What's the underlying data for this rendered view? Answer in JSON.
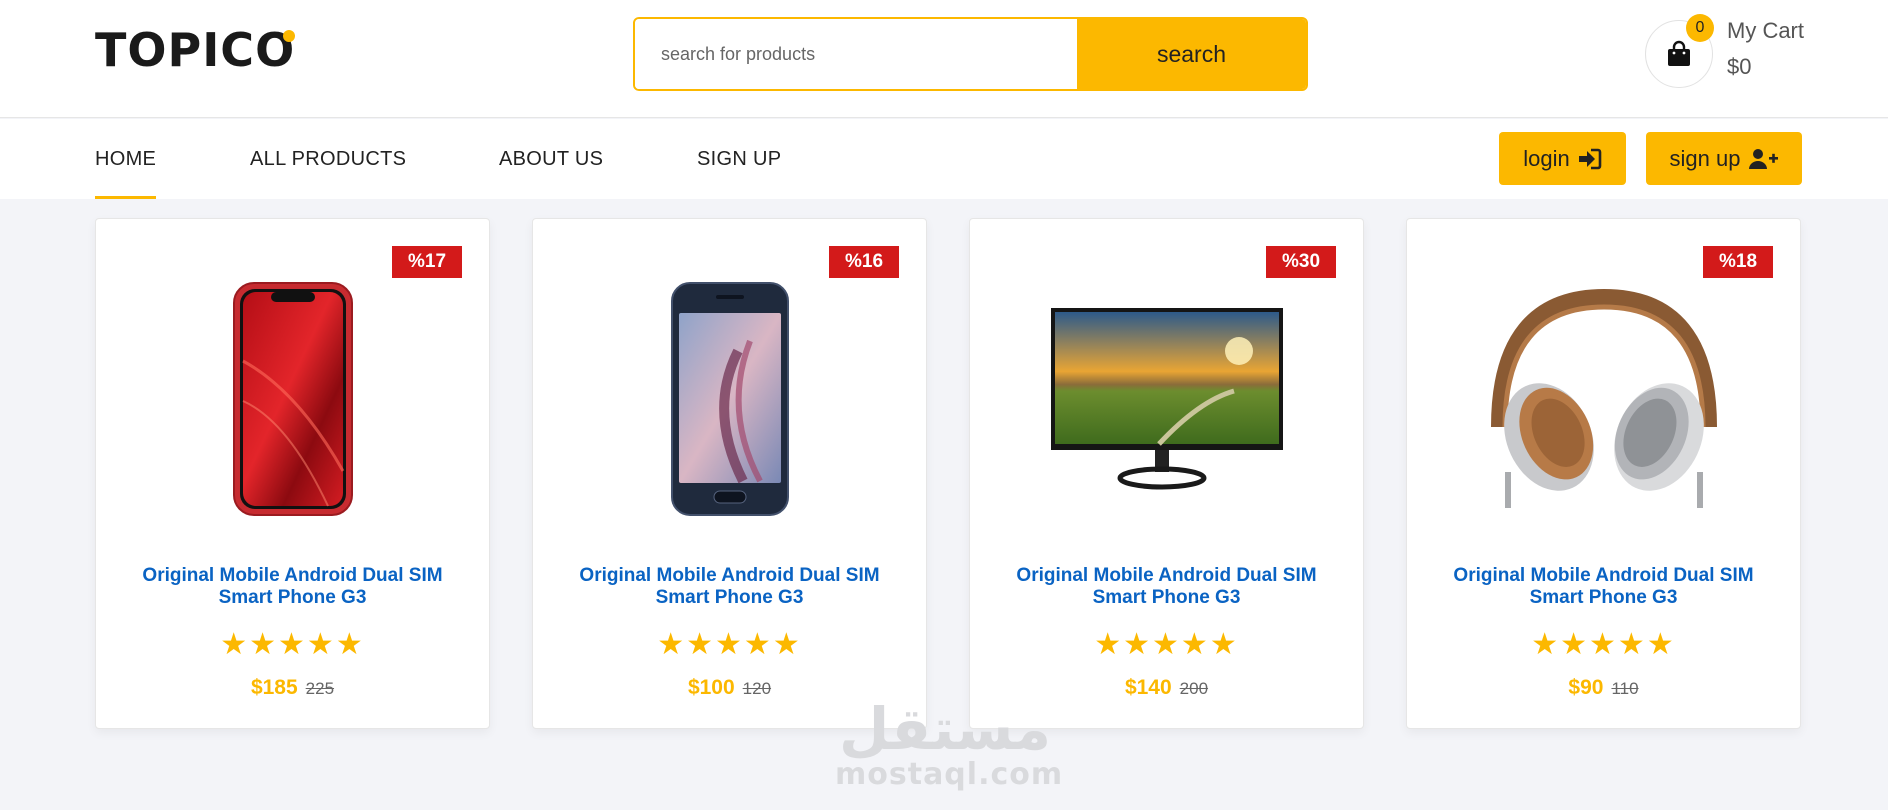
{
  "header": {
    "logo_text": "TOPICO",
    "search": {
      "placeholder": "search for products",
      "button_label": "search"
    },
    "cart": {
      "count": "0",
      "label": "My Cart",
      "total": "$0"
    }
  },
  "nav": {
    "items": [
      {
        "label": "HOME",
        "active": true
      },
      {
        "label": "ALL PRODUCTS"
      },
      {
        "label": "ABOUT US"
      },
      {
        "label": "SIGN UP"
      }
    ],
    "login_label": "login",
    "signup_label": "sign up"
  },
  "products": [
    {
      "discount": "%17",
      "title": "Original Mobile Android Dual SIM Smart Phone G3",
      "rating": 5,
      "stars": "★★★★★",
      "price": "$185",
      "old_price": "225",
      "image": "red-smartphone"
    },
    {
      "discount": "%16",
      "title": "Original Mobile Android Dual SIM Smart Phone G3",
      "rating": 5,
      "stars": "★★★★★",
      "price": "$100",
      "old_price": "120",
      "image": "blue-smartphone"
    },
    {
      "discount": "%30",
      "title": "Original Mobile Android Dual SIM Smart Phone G3",
      "rating": 5,
      "stars": "★★★★★",
      "price": "$140",
      "old_price": "200",
      "image": "monitor"
    },
    {
      "discount": "%18",
      "title": "Original Mobile Android Dual SIM Smart Phone G3",
      "rating": 5,
      "stars": "★★★★★",
      "price": "$90",
      "old_price": "110",
      "image": "headphones"
    }
  ],
  "watermark": {
    "arabic": "مستقل",
    "latin": "mostaql.com"
  },
  "colors": {
    "accent": "#fcb800",
    "discount": "#d31a1a",
    "title": "#0a63c3",
    "background": "#f3f4f8"
  }
}
